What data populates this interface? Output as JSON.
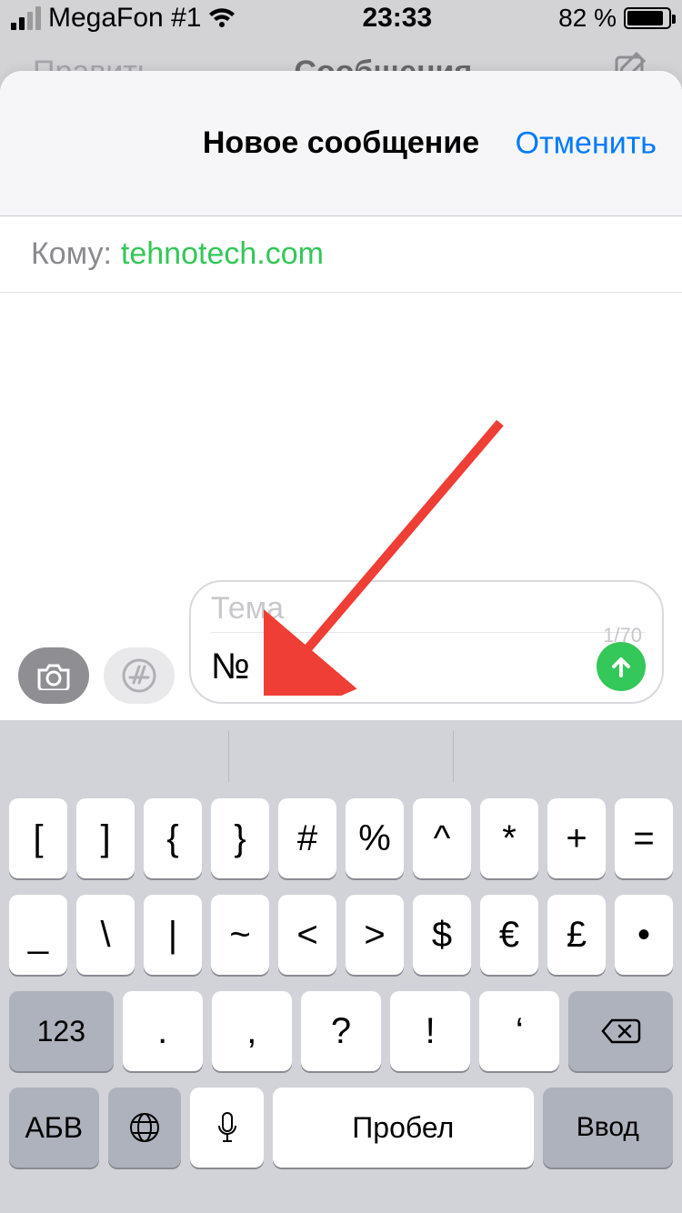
{
  "status": {
    "carrier": "MegaFon #1",
    "time": "23:33",
    "battery_text": "82 %"
  },
  "bg_nav": {
    "edit": "Править",
    "title": "Сообщения"
  },
  "sheet": {
    "title": "Новое сообщение",
    "cancel": "Отменить"
  },
  "to": {
    "label": "Кому:",
    "value": "tehnotech.com"
  },
  "compose": {
    "subject_placeholder": "Тема",
    "counter": "1/70",
    "message_text": "№"
  },
  "kb": {
    "r1": [
      "[",
      "]",
      "{",
      "}",
      "#",
      "%",
      "^",
      "*",
      "+",
      "="
    ],
    "r2": [
      "_",
      "\\",
      "|",
      "~",
      "<",
      ">",
      "$",
      "€",
      "£",
      "•"
    ],
    "r3_num": "123",
    "r3": [
      ".",
      ",",
      "?",
      "!",
      "‘"
    ],
    "r4_abc": "АБВ",
    "space": "Пробел",
    "enter": "Ввод"
  }
}
